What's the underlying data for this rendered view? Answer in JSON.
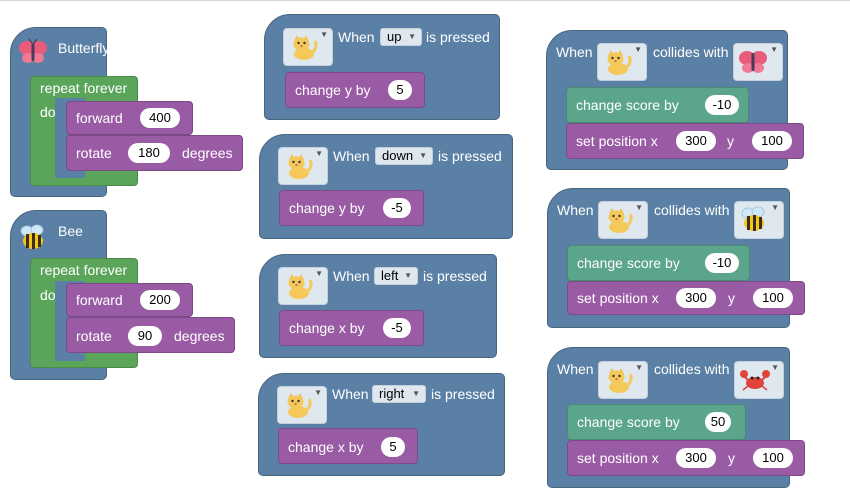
{
  "butterfly": {
    "title": "Butterfly",
    "repeat_label": "repeat forever",
    "do_label": "do",
    "forward_label": "forward",
    "forward_value": "400",
    "rotate_label": "rotate",
    "rotate_value": "180",
    "degrees_label": "degrees"
  },
  "bee": {
    "title": "Bee",
    "repeat_label": "repeat forever",
    "do_label": "do",
    "forward_label": "forward",
    "forward_value": "200",
    "rotate_label": "rotate",
    "rotate_value": "90",
    "degrees_label": "degrees"
  },
  "key_events": [
    {
      "when": "When",
      "key": "up",
      "pressed": "is pressed",
      "action": "change y by",
      "value": "5"
    },
    {
      "when": "When",
      "key": "down",
      "pressed": "is pressed",
      "action": "change y by",
      "value": "-5"
    },
    {
      "when": "When",
      "key": "left",
      "pressed": "is pressed",
      "action": "change x by",
      "value": "-5"
    },
    {
      "when": "When",
      "key": "right",
      "pressed": "is pressed",
      "action": "change x by",
      "value": "5"
    }
  ],
  "collisions": [
    {
      "when": "When",
      "collides": "collides with",
      "target_icon": "butterfly-icon",
      "score_label": "change score by",
      "score": "-10",
      "set_label": "set position x",
      "x": "300",
      "y_label": "y",
      "y": "100"
    },
    {
      "when": "When",
      "collides": "collides with",
      "target_icon": "bee-icon",
      "score_label": "change score by",
      "score": "-10",
      "set_label": "set position x",
      "x": "300",
      "y_label": "y",
      "y": "100"
    },
    {
      "when": "When",
      "collides": "collides with",
      "target_icon": "crab-icon",
      "score_label": "change score by",
      "score": "50",
      "set_label": "set position x",
      "x": "300",
      "y_label": "y",
      "y": "100"
    }
  ],
  "colors": {
    "event_block": "#5b80a5",
    "loop_block": "#5ba55b",
    "motion_block": "#9a5ba5",
    "score_block": "#5ba58c"
  },
  "sprite_icon": "cat-icon"
}
